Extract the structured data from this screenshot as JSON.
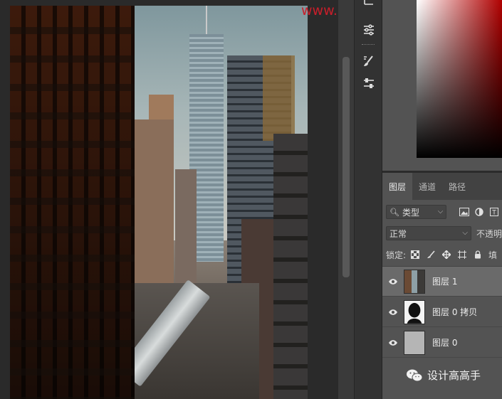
{
  "watermark": "www.hxsjdiansheji.com",
  "colors": {
    "accent_red": "#c81e2a",
    "panel_bg": "#535353",
    "tab_bar_bg": "#424242",
    "selected_layer_bg": "#6a6a6a"
  },
  "toolstrip": {
    "icons": [
      "adjustments-icon",
      "brushes-icon",
      "properties-icon"
    ]
  },
  "layers_panel": {
    "tabs": [
      {
        "label": "图层",
        "active": true
      },
      {
        "label": "通道",
        "active": false
      },
      {
        "label": "路径",
        "active": false
      }
    ],
    "filter": {
      "label": "类型"
    },
    "blend_mode": "正常",
    "opacity_label": "不透明",
    "lock_label": "锁定:",
    "fill_label": "填",
    "layers": [
      {
        "name": "图层 1",
        "selected": true,
        "visible": true,
        "thumb": "photo"
      },
      {
        "name": "图层 0 拷贝",
        "selected": false,
        "visible": true,
        "thumb": "silhouette"
      },
      {
        "name": "图层 0",
        "selected": false,
        "visible": true,
        "thumb": "gray"
      }
    ]
  },
  "brand": {
    "text": "设计高高手"
  }
}
